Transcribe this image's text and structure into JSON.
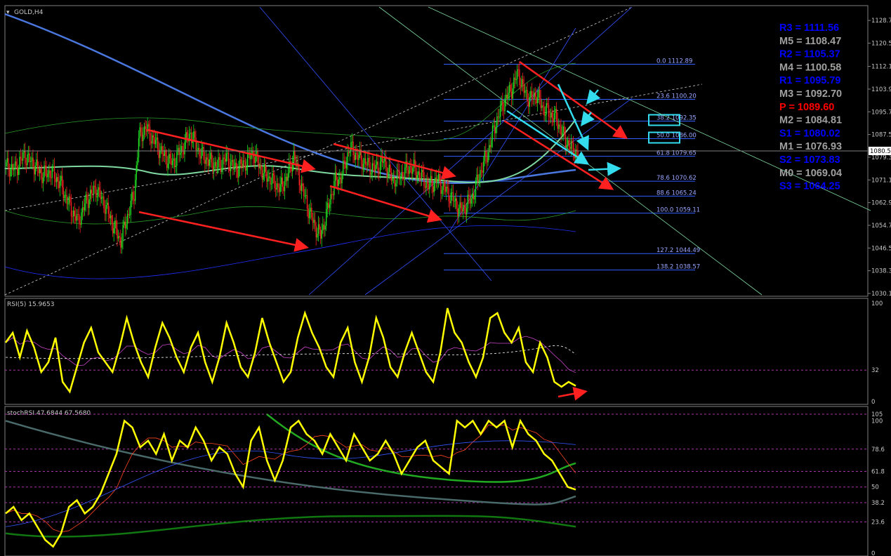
{
  "colors": {
    "background": "#000000",
    "bull_candle": "#22dd22",
    "bear_candle": "#ee2222",
    "rsi_line": "#ffff00",
    "stoch_line": "#ffff00",
    "trend_arrow": "#ff2020",
    "highlight_arrow": "#33ddee",
    "pivot_resistance": "#0000ff",
    "pivot_mid": "#a0a0a0",
    "pivot_main": "#ff0000",
    "fib_line": "#3060ff",
    "ma_blue": "#4a78e0",
    "ma_green": "#7ed8a0"
  },
  "chart_data": [
    {
      "type": "candlestick",
      "title": "GOLD,H4",
      "current_price": "1080.5",
      "yaxis_ticks": [
        "1128.7",
        "1120.5",
        "1112.1",
        "1103.9",
        "1095.7",
        "1087.5",
        "1079.3",
        "1071.1",
        "1062.9",
        "1054.7",
        "1046.5",
        "1038.3",
        "1030.1"
      ],
      "ylim": [
        1030.1,
        1130.5
      ],
      "fibonacci": [
        {
          "level": "0.0",
          "price": "1112.89"
        },
        {
          "level": "23.6",
          "price": "1100.20"
        },
        {
          "level": "38.2",
          "price": "1092.35"
        },
        {
          "level": "50.0",
          "price": "1086.00"
        },
        {
          "level": "61.8",
          "price": "1079.65"
        },
        {
          "level": "78.6",
          "price": "1070.62"
        },
        {
          "level": "88.6",
          "price": "1065.24"
        },
        {
          "level": "100.0",
          "price": "1059.11"
        },
        {
          "level": "127.2",
          "price": "1044.49"
        },
        {
          "level": "138.2",
          "price": "1038.57"
        }
      ],
      "pivots": [
        {
          "label": "R3",
          "value": "1111.56",
          "kind": "resistance"
        },
        {
          "label": "M5",
          "value": "1108.47",
          "kind": "mid"
        },
        {
          "label": "R2",
          "value": "1105.37",
          "kind": "resistance"
        },
        {
          "label": "M4",
          "value": "1100.58",
          "kind": "mid"
        },
        {
          "label": "R1",
          "value": "1095.79",
          "kind": "resistance"
        },
        {
          "label": "M3",
          "value": "1092.70",
          "kind": "mid"
        },
        {
          "label": "P",
          "value": "1089.60",
          "kind": "main"
        },
        {
          "label": "M2",
          "value": "1084.81",
          "kind": "mid"
        },
        {
          "label": "S1",
          "value": "1080.02",
          "kind": "resistance"
        },
        {
          "label": "M1",
          "value": "1076.93",
          "kind": "mid"
        },
        {
          "label": "S2",
          "value": "1073.83",
          "kind": "resistance"
        },
        {
          "label": "M0",
          "value": "1069.04",
          "kind": "mid"
        },
        {
          "label": "S3",
          "value": "1064.25",
          "kind": "resistance"
        }
      ],
      "close_path": [
        [
          0,
          1076
        ],
        [
          8,
          1075
        ],
        [
          16,
          1080
        ],
        [
          24,
          1077
        ],
        [
          32,
          1073
        ],
        [
          40,
          1074
        ],
        [
          48,
          1070
        ],
        [
          56,
          1062
        ],
        [
          64,
          1056
        ],
        [
          72,
          1064
        ],
        [
          80,
          1068
        ],
        [
          88,
          1062
        ],
        [
          96,
          1054
        ],
        [
          102,
          1049
        ],
        [
          108,
          1058
        ],
        [
          114,
          1066
        ],
        [
          118,
          1086
        ],
        [
          124,
          1090
        ],
        [
          132,
          1085
        ],
        [
          140,
          1080
        ],
        [
          148,
          1077
        ],
        [
          156,
          1082
        ],
        [
          164,
          1088
        ],
        [
          172,
          1081
        ],
        [
          180,
          1078
        ],
        [
          188,
          1076
        ],
        [
          196,
          1079
        ],
        [
          204,
          1075
        ],
        [
          212,
          1077
        ],
        [
          220,
          1081
        ],
        [
          228,
          1074
        ],
        [
          236,
          1071
        ],
        [
          244,
          1068
        ],
        [
          250,
          1072
        ],
        [
          256,
          1080
        ],
        [
          262,
          1070
        ],
        [
          268,
          1062
        ],
        [
          274,
          1055
        ],
        [
          280,
          1051
        ],
        [
          286,
          1060
        ],
        [
          292,
          1070
        ],
        [
          298,
          1072
        ],
        [
          306,
          1083
        ],
        [
          312,
          1080
        ],
        [
          320,
          1077
        ],
        [
          328,
          1075
        ],
        [
          336,
          1078
        ],
        [
          344,
          1071
        ],
        [
          352,
          1073
        ],
        [
          360,
          1076
        ],
        [
          368,
          1073
        ],
        [
          376,
          1069
        ],
        [
          384,
          1071
        ],
        [
          392,
          1067
        ],
        [
          398,
          1064
        ],
        [
          404,
          1060
        ],
        [
          410,
          1062
        ],
        [
          416,
          1066
        ],
        [
          422,
          1074
        ],
        [
          428,
          1080
        ],
        [
          436,
          1092
        ],
        [
          444,
          1100
        ],
        [
          450,
          1104
        ],
        [
          456,
          1110
        ],
        [
          460,
          1104
        ],
        [
          466,
          1100
        ],
        [
          472,
          1102
        ],
        [
          478,
          1097
        ],
        [
          484,
          1095
        ],
        [
          490,
          1093
        ],
        [
          496,
          1087
        ],
        [
          502,
          1083
        ],
        [
          510,
          1080
        ]
      ]
    },
    {
      "type": "line",
      "title": "RSI(5) 15.9653",
      "yaxis_ticks": [
        "100",
        "32",
        "0"
      ],
      "ylim": [
        0,
        100
      ],
      "series": [
        {
          "name": "RSI(5)",
          "values": [
            60,
            70,
            45,
            72,
            55,
            30,
            40,
            65,
            20,
            10,
            35,
            60,
            75,
            50,
            40,
            30,
            55,
            85,
            60,
            40,
            25,
            55,
            80,
            65,
            45,
            30,
            55,
            70,
            40,
            20,
            45,
            80,
            60,
            35,
            25,
            50,
            85,
            60,
            40,
            20,
            30,
            65,
            90,
            70,
            55,
            35,
            25,
            60,
            75,
            40,
            20,
            45,
            85,
            65,
            35,
            25,
            50,
            70,
            50,
            30,
            20,
            50,
            95,
            70,
            60,
            40,
            25,
            45,
            85,
            90,
            70,
            60,
            75,
            40,
            30,
            60,
            45,
            20,
            15,
            20,
            16
          ]
        }
      ]
    },
    {
      "type": "line",
      "title": "stochRSI 47.6844 67.5680",
      "yaxis_ticks": [
        "105",
        "100",
        "78.6",
        "61.8",
        "50",
        "38.2",
        "23.6",
        "0"
      ],
      "ylim": [
        0,
        105
      ],
      "series": [
        {
          "name": "stochRSI",
          "values": [
            30,
            35,
            25,
            30,
            20,
            10,
            5,
            15,
            35,
            40,
            30,
            35,
            45,
            60,
            75,
            100,
            95,
            80,
            85,
            75,
            90,
            70,
            85,
            80,
            95,
            85,
            70,
            80,
            75,
            60,
            50,
            85,
            95,
            70,
            55,
            70,
            95,
            100,
            90,
            85,
            75,
            90,
            80,
            70,
            90,
            80,
            70,
            75,
            85,
            75,
            60,
            70,
            80,
            85,
            70,
            65,
            60,
            100,
            95,
            100,
            90,
            100,
            95,
            100,
            80,
            100,
            90,
            85,
            75,
            70,
            60,
            50,
            48
          ]
        }
      ]
    }
  ]
}
